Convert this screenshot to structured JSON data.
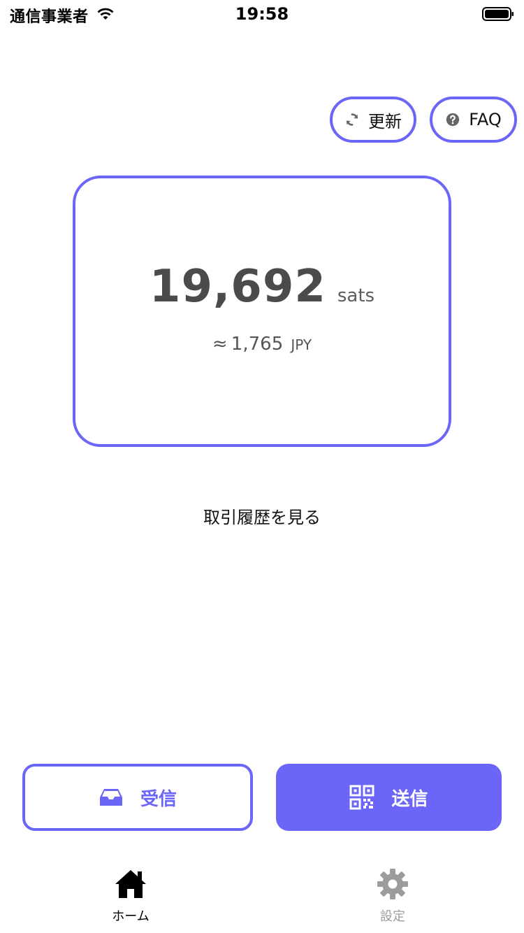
{
  "status_bar": {
    "carrier": "通信事業者",
    "time": "19:58",
    "wifi_icon": "wifi-icon",
    "battery_icon": "battery-icon"
  },
  "header": {
    "update_button": {
      "label": "更新",
      "icon": "refresh-icon"
    },
    "faq_button": {
      "label": "FAQ",
      "icon": "question-circle-icon"
    }
  },
  "balance": {
    "amount": "19,692",
    "unit": "sats",
    "fiat_prefix": "≈",
    "fiat_value": "1,765",
    "fiat_currency": "JPY"
  },
  "history_link": "取引履歴を見る",
  "actions": {
    "receive": {
      "label": "受信",
      "icon": "inbox-icon"
    },
    "send": {
      "label": "送信",
      "icon": "qr-code-icon"
    }
  },
  "tab_bar": {
    "home": {
      "label": "ホーム",
      "icon": "home-icon",
      "active": true
    },
    "settings": {
      "label": "設定",
      "icon": "gear-icon",
      "active": false
    }
  },
  "colors": {
    "accent": "#6b66f7",
    "amount_text": "#4b4b4b",
    "inactive_tab": "#9c9c9c"
  }
}
